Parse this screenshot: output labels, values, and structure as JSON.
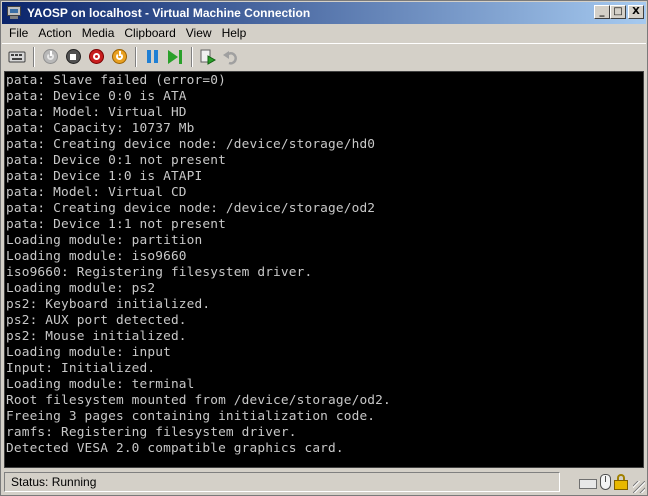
{
  "window": {
    "title": "YAOSP on localhost - Virtual Machine Connection",
    "minimize_glyph": "_",
    "maximize_glyph": "□",
    "close_glyph": "X"
  },
  "menu": {
    "items": [
      "File",
      "Action",
      "Media",
      "Clipboard",
      "View",
      "Help"
    ]
  },
  "toolbar": {
    "icons": [
      "ctrl-alt-del-icon",
      "start-icon",
      "turn-off-icon",
      "shut-down-icon",
      "save-state-icon",
      "pause-icon",
      "resume-icon",
      "snapshot-icon",
      "revert-icon"
    ]
  },
  "console": {
    "lines": [
      "pata: Slave failed (error=0)",
      "pata: Device 0:0 is ATA",
      "pata: Model: Virtual HD",
      "pata: Capacity: 10737 Mb",
      "pata: Creating device node: /device/storage/hd0",
      "pata: Device 0:1 not present",
      "pata: Device 1:0 is ATAPI",
      "pata: Model: Virtual CD",
      "pata: Creating device node: /device/storage/od2",
      "pata: Device 1:1 not present",
      "Loading module: partition",
      "Loading module: iso9660",
      "iso9660: Registering filesystem driver.",
      "Loading module: ps2",
      "ps2: Keyboard initialized.",
      "ps2: AUX port detected.",
      "ps2: Mouse initialized.",
      "Loading module: input",
      "Input: Initialized.",
      "Loading module: terminal",
      "Root filesystem mounted from /device/storage/od2.",
      "Freeing 3 pages containing initialization code.",
      "ramfs: Registering filesystem driver.",
      "Detected VESA 2.0 compatible graphics card."
    ]
  },
  "status": {
    "text": "Status: Running"
  },
  "colors": {
    "titlebar_start": "#0a246a",
    "titlebar_end": "#a6caf0",
    "console_bg": "#000000",
    "console_fg": "#c8c8c8"
  }
}
